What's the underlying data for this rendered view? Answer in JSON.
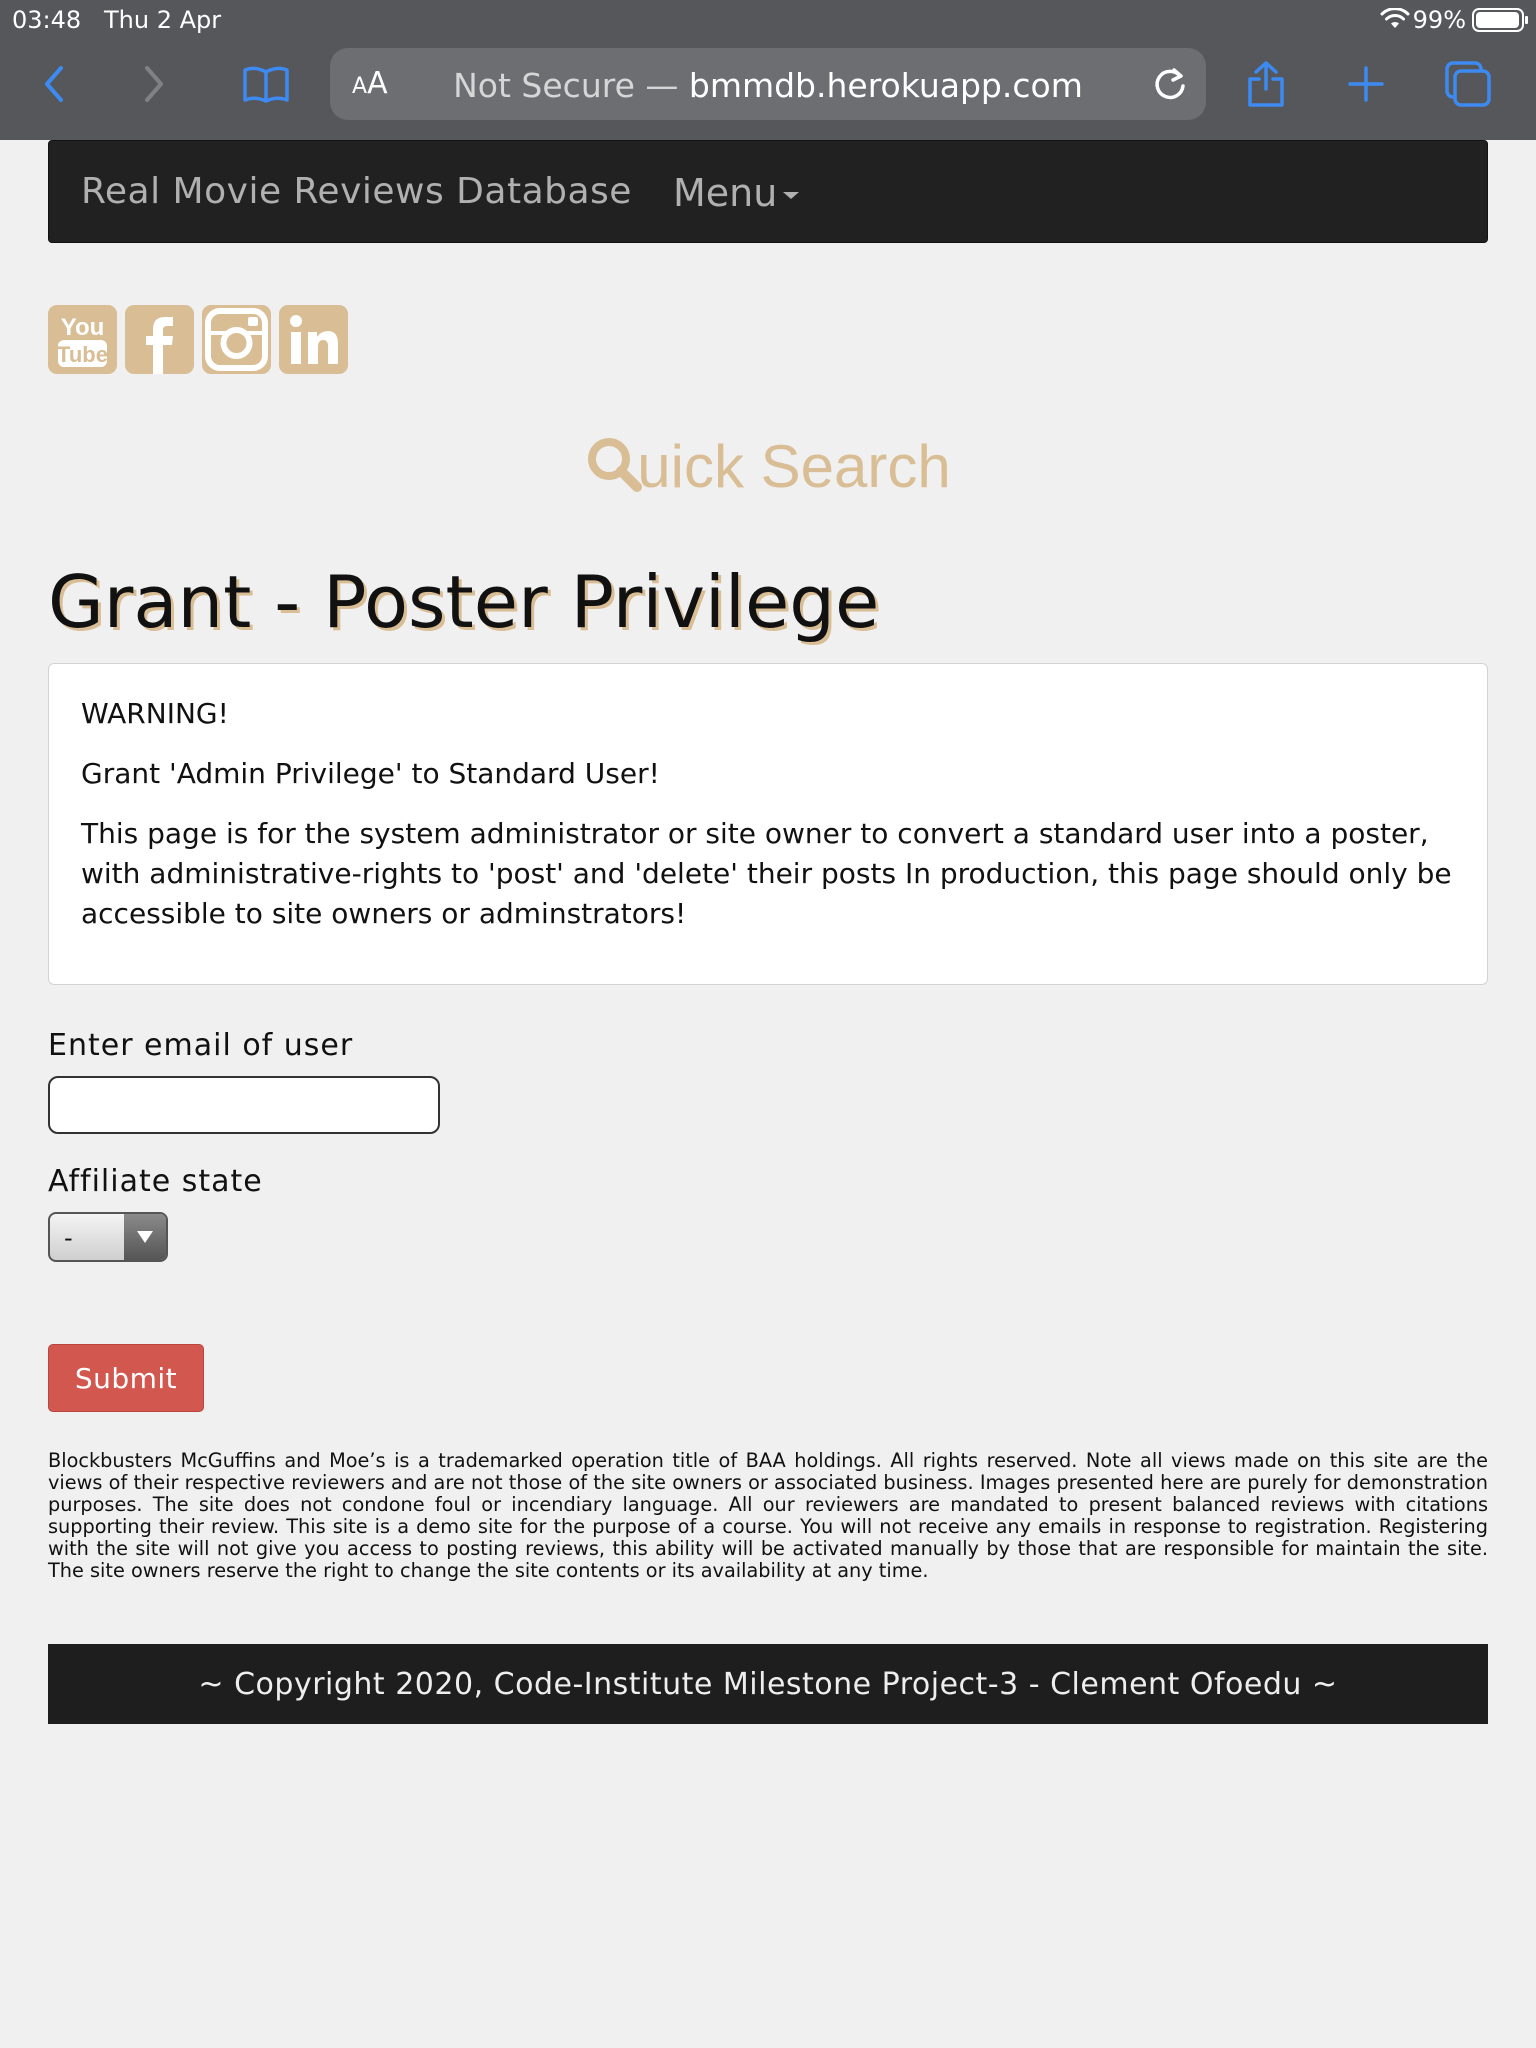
{
  "status_bar": {
    "time": "03:48",
    "date": "Thu 2 Apr",
    "battery": "99%"
  },
  "browser": {
    "text_size_label": "AA",
    "security": "Not Secure —",
    "domain": "bmmdb.herokuapp.com",
    "icons": [
      "back-icon",
      "forward-icon",
      "bookmarks-icon",
      "reload-icon",
      "share-icon",
      "new-tab-icon",
      "tabs-icon"
    ]
  },
  "navbar": {
    "brand": "Real Movie Reviews Database",
    "menu": "Menu"
  },
  "social": [
    "youtube-icon",
    "facebook-icon",
    "instagram-icon",
    "linkedin-icon"
  ],
  "quick_search": {
    "first_letter": "Q",
    "rest": "uick Search"
  },
  "page_title": "Grant - Poster Privilege",
  "warning": {
    "heading": "WARNING!",
    "subheading": "Grant 'Admin Privilege' to Standard User!",
    "body": "This page is for the system administrator or site owner to convert a standard user into a poster, with administrative-rights to 'post' and 'delete' their posts In production, this page should only be accessible to site owners or adminstrators!"
  },
  "form": {
    "email_label": "Enter email of user",
    "email_value": "",
    "affiliate_label": "Affiliate state",
    "affiliate_value": "-",
    "submit_label": "Submit"
  },
  "disclaimer": "Blockbusters McGuffins and Moe’s is a trademarked operation title of BAA holdings. All rights reserved. Note all views made on this site are the views of their respective reviewers and are not those of the site owners or associated business. Images presented here are purely for demonstration purposes. The site does not condone foul or incendiary language. All our reviewers are mandated to present balanced reviews with citations supporting their review. This site is a demo site for the purpose of a course. You will not receive any emails in response to registration. Registering with the site will not give you access to posting reviews, this ability will be activated manually by those that are responsible for maintain the site. The site owners reserve the right to change the site contents or its availability at any time.",
  "footer": "~ Copyright 2020, Code-Institute Milestone Project-3 - Clement Ofoedu ~",
  "colors": {
    "accent_tan": "#d9bd95",
    "navbar_bg": "#212121",
    "submit_red": "#d2574f",
    "page_bg": "#eff0ef",
    "safari_blue": "#3d8bf2"
  }
}
